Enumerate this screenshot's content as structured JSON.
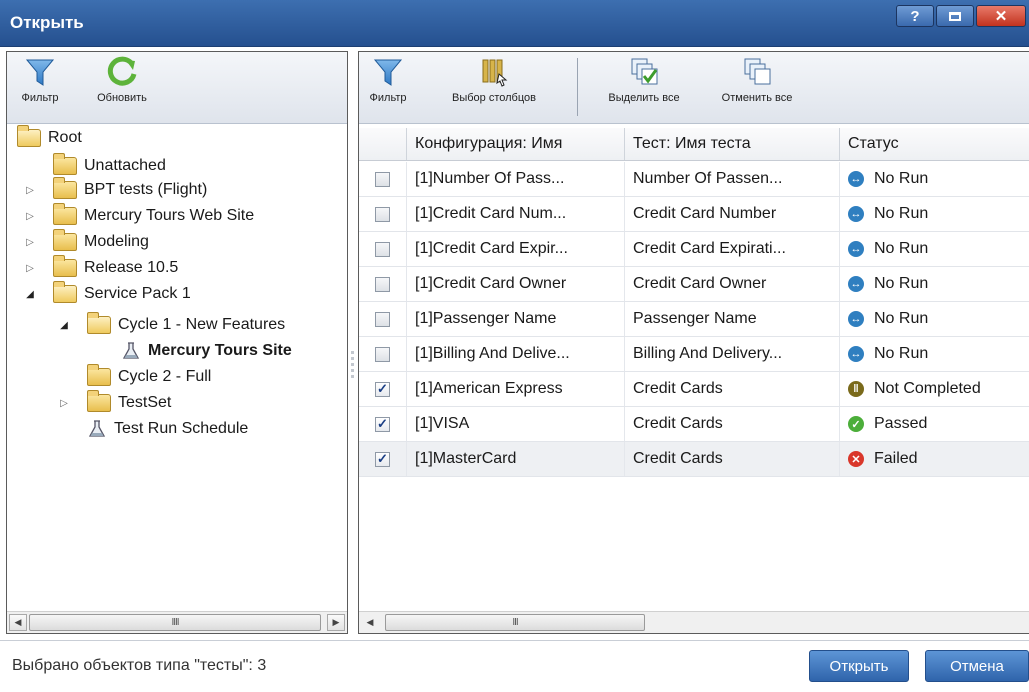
{
  "window": {
    "title": "Открыть",
    "help_label": "?",
    "close_label": "✕"
  },
  "left_toolbar": {
    "filter_label": "Фильтр",
    "refresh_label": "Обновить"
  },
  "tree": {
    "root": "Root",
    "items": [
      {
        "label": "Unattached"
      },
      {
        "label": "BPT tests (Flight)"
      },
      {
        "label": "Mercury Tours Web Site"
      },
      {
        "label": "Modeling"
      },
      {
        "label": "Release 10.5"
      },
      {
        "label": "Service Pack 1"
      },
      {
        "label": "Cycle 1 - New Features"
      },
      {
        "label": "Mercury Tours Site"
      },
      {
        "label": "Cycle 2 - Full"
      },
      {
        "label": "TestSet"
      },
      {
        "label": "Test Run Schedule"
      }
    ]
  },
  "right_toolbar": {
    "filter_label": "Фильтр",
    "columns_label": "Выбор столбцов",
    "select_all_label": "Выделить все",
    "deselect_all_label": "Отменить все"
  },
  "grid": {
    "columns": [
      "Конфигурация: Имя",
      "Тест: Имя теста",
      "Статус"
    ],
    "rows": [
      {
        "config": "[1]Number Of Pass...",
        "test": "Number Of Passen...",
        "status": "No Run",
        "checked": false
      },
      {
        "config": "[1]Credit Card Num...",
        "test": "Credit Card Number",
        "status": "No Run",
        "checked": false
      },
      {
        "config": "[1]Credit Card Expir...",
        "test": "Credit Card Expirati...",
        "status": "No Run",
        "checked": false
      },
      {
        "config": "[1]Credit Card Owner",
        "test": "Credit Card Owner",
        "status": "No Run",
        "checked": false
      },
      {
        "config": "[1]Passenger Name",
        "test": "Passenger Name",
        "status": "No Run",
        "checked": false
      },
      {
        "config": "[1]Billing And Delive...",
        "test": "Billing And Delivery...",
        "status": "No Run",
        "checked": false
      },
      {
        "config": "[1]American Express",
        "test": "Credit Cards",
        "status": "Not Completed",
        "checked": true
      },
      {
        "config": "[1]VISA",
        "test": "Credit Cards",
        "status": "Passed",
        "checked": true
      },
      {
        "config": "[1]MasterCard",
        "test": "Credit Cards",
        "status": "Failed",
        "checked": true
      }
    ]
  },
  "footer": {
    "status_text": "Выбрано объектов типа \"тесты\": 3",
    "open_label": "Открыть",
    "cancel_label": "Отмена"
  },
  "colors": {
    "titlebar": "#2d5d9e",
    "no_run": "#2f7fc0",
    "not_completed": "#7a6a1b",
    "passed": "#4cae3a",
    "failed": "#d9372b"
  }
}
